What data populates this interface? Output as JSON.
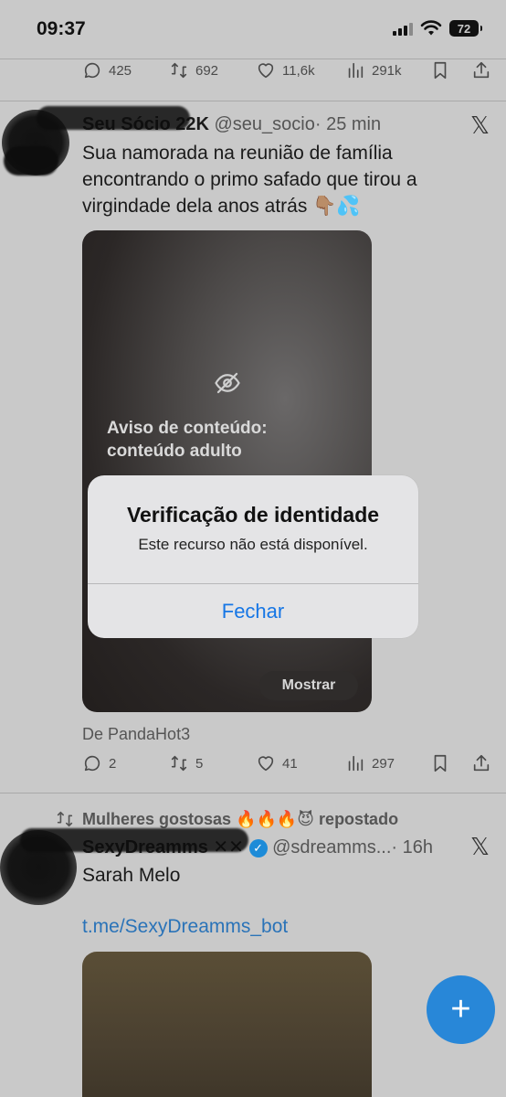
{
  "status_bar": {
    "time": "09:37",
    "battery": "72"
  },
  "top_actions": {
    "replies": "425",
    "reposts": "692",
    "likes": "11,6k",
    "views": "291k"
  },
  "tweet1": {
    "name": "Seu Sócio 22K",
    "handle": "@seu_socio",
    "time": "· 25 min",
    "text": "Sua namorada na reunião de família encontrando o primo safado que tirou a virgindade dela anos atrás 👇🏽💦",
    "content_warning_line1": "Aviso de conteúdo:",
    "content_warning_line2": "conteúdo adulto",
    "show_button": "Mostrar",
    "source": "De PandaHot3",
    "actions": {
      "replies": "2",
      "reposts": "5",
      "likes": "41",
      "views": "297"
    }
  },
  "alert": {
    "title": "Verificação de identidade",
    "message": "Este recurso não está disponível.",
    "button": "Fechar"
  },
  "tweet2": {
    "repost_label": "Mulheres gostosas 🔥🔥🔥😈 repostado",
    "name": "SexyDreamms ✕✕",
    "handle": "@sdreamms...",
    "time": "· 16h",
    "text": "Sarah Melo",
    "link": "t.me/SexyDreamms_bot"
  },
  "fab": {
    "label": "+"
  },
  "x_logo": "𝕏",
  "colors": {
    "accent": "#1676e5",
    "fab": "#2887d8",
    "link": "#2a73b8",
    "verified": "#1d8bd8"
  }
}
